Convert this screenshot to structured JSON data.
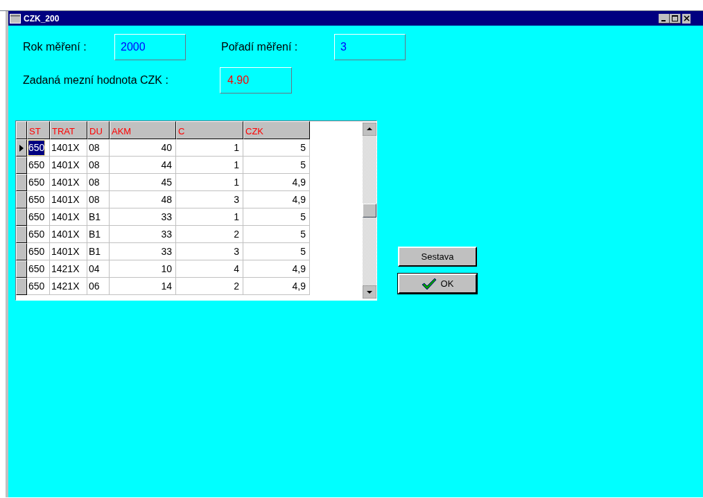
{
  "window": {
    "title": "CZK_200"
  },
  "fields": [
    {
      "label": "Rok měření :",
      "value": "2000",
      "color": "#0000ff"
    },
    {
      "label": "Pořadí měření :",
      "value": "3",
      "color": "#0000ff"
    },
    {
      "label": "Zadaná mezní hodnota CZK :",
      "value": "4.90",
      "color": "#ff0000"
    }
  ],
  "table": {
    "columns": [
      {
        "label": "ST"
      },
      {
        "label": "TRAT"
      },
      {
        "label": "DU"
      },
      {
        "label": "AKM"
      },
      {
        "label": "C"
      },
      {
        "label": "CZK"
      }
    ],
    "rows": [
      {
        "current": true,
        "cells": [
          "650",
          "1401X",
          "08",
          "40",
          "1",
          "5"
        ]
      },
      {
        "current": false,
        "cells": [
          "650",
          "1401X",
          "08",
          "44",
          "1",
          "5"
        ]
      },
      {
        "current": false,
        "cells": [
          "650",
          "1401X",
          "08",
          "45",
          "1",
          "4,9"
        ]
      },
      {
        "current": false,
        "cells": [
          "650",
          "1401X",
          "08",
          "48",
          "3",
          "4,9"
        ]
      },
      {
        "current": false,
        "cells": [
          "650",
          "1401X",
          "B1",
          "33",
          "1",
          "5"
        ]
      },
      {
        "current": false,
        "cells": [
          "650",
          "1401X",
          "B1",
          "33",
          "2",
          "5"
        ]
      },
      {
        "current": false,
        "cells": [
          "650",
          "1401X",
          "B1",
          "33",
          "3",
          "5"
        ]
      },
      {
        "current": false,
        "cells": [
          "650",
          "1421X",
          "04",
          "10",
          "4",
          "4,9"
        ]
      },
      {
        "current": false,
        "cells": [
          "650",
          "1421X",
          "06",
          "14",
          "2",
          "4,9"
        ]
      }
    ]
  },
  "buttons": [
    {
      "kind": "plain",
      "label": "Sestava"
    },
    {
      "kind": "check",
      "label": "OK"
    }
  ]
}
